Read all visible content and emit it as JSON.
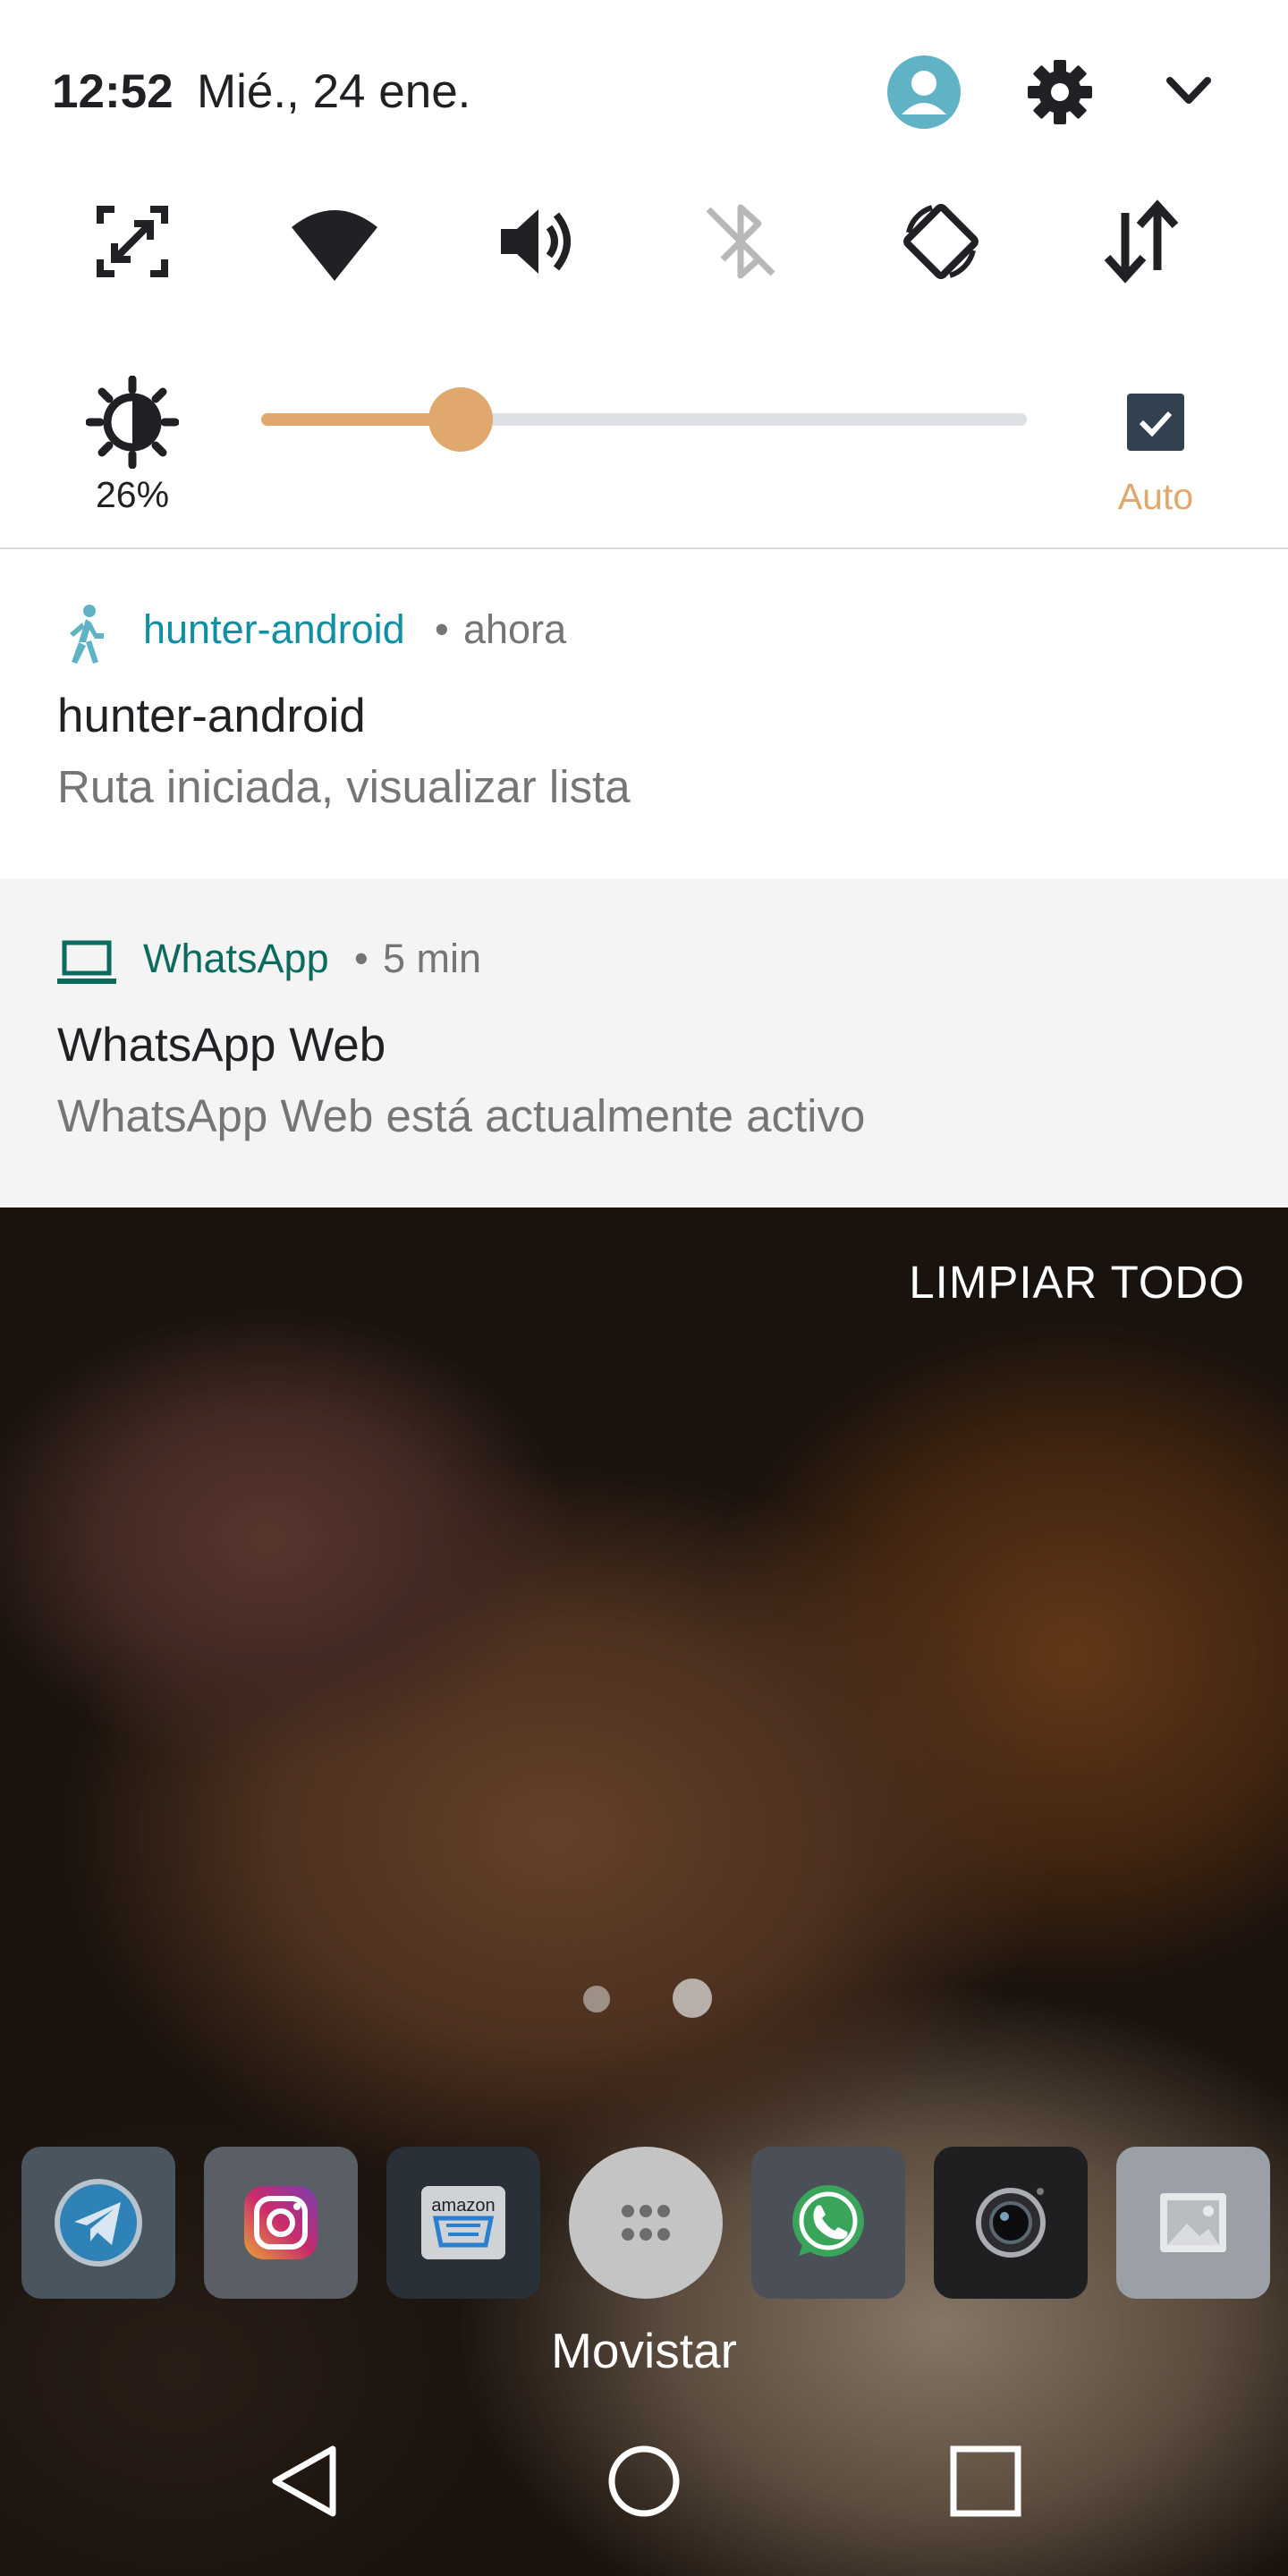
{
  "status_bar": {
    "time": "12:52",
    "date": "Mié., 24 ene."
  },
  "quick_settings": {
    "tiles": [
      "screen-expand-icon",
      "wifi-icon",
      "volume-icon",
      "bluetooth-off-icon",
      "auto-rotate-icon",
      "data-transfer-icon"
    ],
    "brightness": {
      "value_fraction": 0.26,
      "percent_label": "26%",
      "auto_label": "Auto",
      "auto_checked": true
    },
    "colors": {
      "accent": "#e1a86e",
      "track": "#dde0e5",
      "checkbox": "#33404f"
    }
  },
  "notifications": [
    {
      "app_name": "hunter-android",
      "app_color": "#0e8fa3",
      "time": "ahora",
      "title": "hunter-android",
      "text": "Ruta iniciada, visualizar lista",
      "icon": "walking-person-icon"
    },
    {
      "app_name": "WhatsApp",
      "app_color": "#0b6b5e",
      "time": "5 min",
      "title": "WhatsApp Web",
      "text": "WhatsApp Web está actualmente activo",
      "icon": "laptop-icon"
    }
  ],
  "clear_all_label": "LIMPIAR TODO",
  "dock": {
    "apps": [
      "telegram-icon",
      "instagram-icon",
      "amazon-icon",
      "app-drawer-icon",
      "whatsapp-icon",
      "camera-icon",
      "gallery-icon"
    ],
    "amazon_text": "amazon"
  },
  "carrier": "Movistar",
  "nav": [
    "back-button",
    "home-button",
    "recents-button"
  ]
}
